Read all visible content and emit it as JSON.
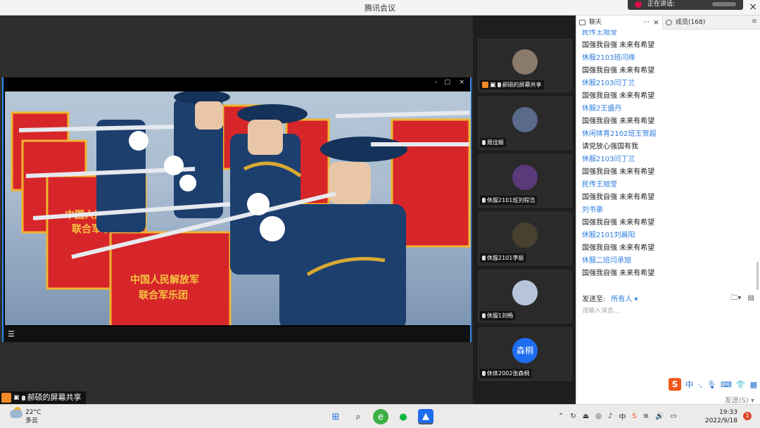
{
  "window": {
    "title": "腾讯会议",
    "speaking_label": "正在讲话:"
  },
  "share": {
    "sharer_label": "郝硕的屏幕共享",
    "video_caption": "中国人民解放军 联合军乐团",
    "controls": [
      "–",
      "□",
      "×"
    ]
  },
  "participants": [
    {
      "name": "郝硕的屏幕共享",
      "avatar_color": "#8a7a6a"
    },
    {
      "name": "周佳颖",
      "avatar_color": "#5a6a8a"
    },
    {
      "name": "休服2101班刘程浩",
      "avatar_color": "#5a3a7a"
    },
    {
      "name": "休服2101李振",
      "avatar_color": "#4a4030"
    },
    {
      "name": "休服1刘畅",
      "avatar_color": "#b8c4dc"
    },
    {
      "name": "休体2002张森桐",
      "avatar_text": "森桐",
      "avatar_color": "#1e6cf0"
    }
  ],
  "chat": {
    "tab_chat": "聊天",
    "tab_members": "成员(168)",
    "messages": [
      {
        "type": "user",
        "text": "民传王旭莹"
      },
      {
        "type": "text",
        "text": "国强我自强 未来有希望"
      },
      {
        "type": "user",
        "text": "休服2103班闫缘"
      },
      {
        "type": "text",
        "text": "国强我自强 未来有希望"
      },
      {
        "type": "user",
        "text": "休服2103闫丁兰"
      },
      {
        "type": "text",
        "text": "国强我自强 未来有希望"
      },
      {
        "type": "user",
        "text": "休服2王盛丹"
      },
      {
        "type": "text",
        "text": "国强我自强 未来有希望"
      },
      {
        "type": "user",
        "text": "休闲体育2102班王贺超"
      },
      {
        "type": "text",
        "text": "请党放心强国有我"
      },
      {
        "type": "user",
        "text": "休服2103闫丁兰"
      },
      {
        "type": "text",
        "text": "国强我自强 未来有希望"
      },
      {
        "type": "user",
        "text": "民传王旭莹"
      },
      {
        "type": "text",
        "text": "国强我自强 未来有希望"
      },
      {
        "type": "user",
        "text": "刘书豪"
      },
      {
        "type": "text",
        "text": "国强我自强 未来有希望"
      },
      {
        "type": "user",
        "text": "休服2101刘晨阳"
      },
      {
        "type": "text",
        "text": "国强我自强 未来有希望"
      },
      {
        "type": "user",
        "text": "休服二班闫承旭"
      },
      {
        "type": "text",
        "text": "国强我自强 未来有希望"
      }
    ],
    "send_to_label": "发送至:",
    "send_to_value": "所有人",
    "input_placeholder": "请输入消息...",
    "send_button": "发送(S)",
    "ime_label": "中"
  },
  "taskbar": {
    "temperature": "22°C",
    "weather": "多云",
    "time": "19:33",
    "date": "2022/9/18",
    "ime": "中",
    "notifications": "1"
  }
}
